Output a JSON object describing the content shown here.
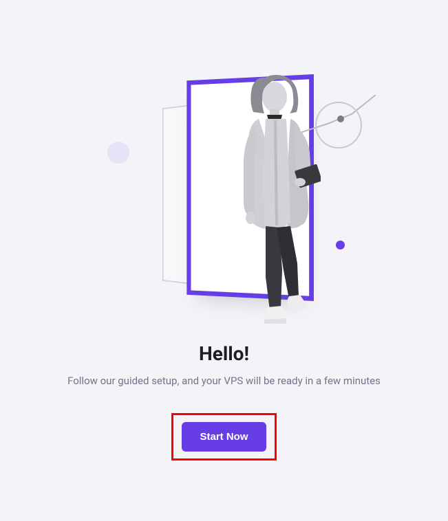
{
  "hero": {
    "heading": "Hello!",
    "subtext": "Follow our guided setup, and your VPS will be ready in a few minutes",
    "cta_label": "Start Now"
  }
}
